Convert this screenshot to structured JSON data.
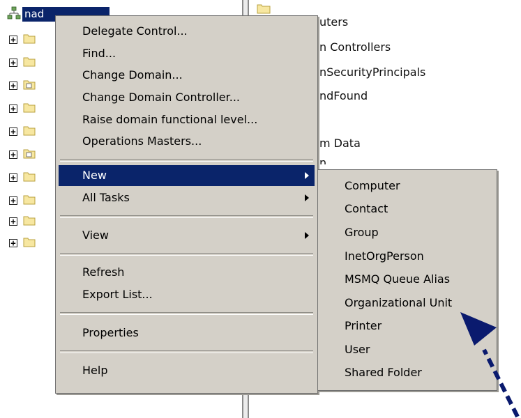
{
  "tree": {
    "root_label": "nad",
    "children_count_visible": 10
  },
  "right_pane": {
    "items": [
      "uters",
      "n Controllers",
      "nSecurityPrincipals",
      "ndFound",
      "m Data",
      "n"
    ]
  },
  "context_menu": {
    "items": [
      {
        "label": "Delegate Control..."
      },
      {
        "label": "Find..."
      },
      {
        "label": "Change Domain..."
      },
      {
        "label": "Change Domain Controller..."
      },
      {
        "label": "Raise domain functional level..."
      },
      {
        "label": "Operations Masters..."
      },
      {
        "label": "New"
      },
      {
        "label": "All Tasks"
      },
      {
        "label": "View"
      },
      {
        "label": "Refresh"
      },
      {
        "label": "Export List..."
      },
      {
        "label": "Properties"
      },
      {
        "label": "Help"
      }
    ]
  },
  "submenu_new": {
    "items": [
      {
        "label": "Computer"
      },
      {
        "label": "Contact"
      },
      {
        "label": "Group"
      },
      {
        "label": "InetOrgPerson"
      },
      {
        "label": "MSMQ Queue Alias"
      },
      {
        "label": "Organizational Unit"
      },
      {
        "label": "Printer"
      },
      {
        "label": "User"
      },
      {
        "label": "Shared Folder"
      }
    ]
  },
  "colors": {
    "highlight": "#0a246a",
    "menu_bg": "#d4d0c8",
    "arrow": "#0a1a6e"
  }
}
